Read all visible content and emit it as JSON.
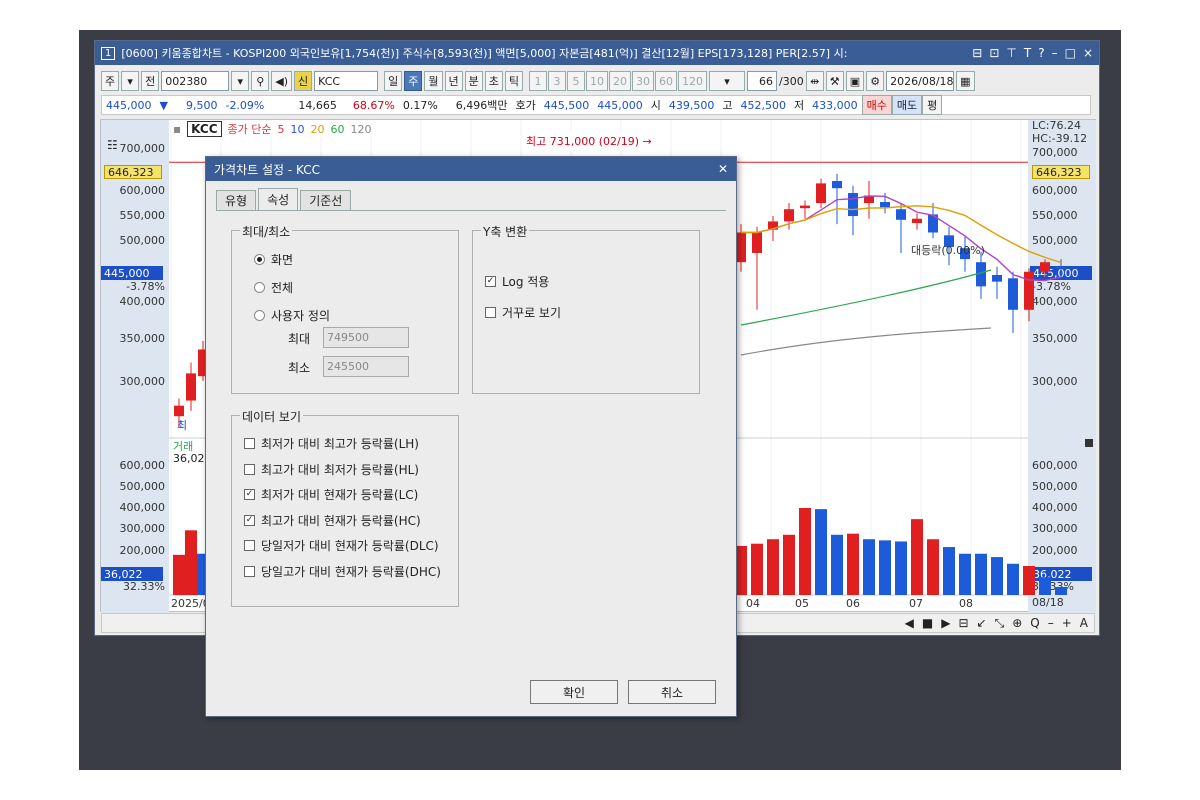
{
  "main_window": {
    "number_badge": "1",
    "title": "[0600] 키움종합차트 - KOSPI200 외국인보유[1,754(천)] 주식수[8,593(천)] 액면[5,000] 자본금[481(억)] 결산[12월] EPS[173,128] PER[2.57] 시:",
    "controls": [
      "⊟",
      "⊡",
      "⊤",
      "T",
      "?",
      "–",
      "□",
      "×"
    ]
  },
  "toolbar": {
    "mode_a": "주",
    "mode_b": "전",
    "code": "002380",
    "badge": "신",
    "stock_name": "KCC",
    "periods": [
      "일",
      "주",
      "월",
      "년",
      "분",
      "초",
      "틱"
    ],
    "active_period": "주",
    "intervals": [
      "1",
      "3",
      "5",
      "10",
      "20",
      "30",
      "60",
      "120"
    ],
    "count": "66",
    "count_total": "/300",
    "date": "2026/08/18"
  },
  "quote": {
    "price": "445,000",
    "arrow": "▼",
    "change": "9,500",
    "change_pct": "-2.09%",
    "volume": "14,665",
    "vol_ratio": "68.67%",
    "turnover": "0.17%",
    "amount": "6,496백만",
    "bid_label": "호가",
    "ask_price": "445,500",
    "bid_price": "445,000",
    "open_label": "시",
    "open": "439,500",
    "high_label": "고",
    "high": "452,500",
    "low_label": "저",
    "low": "433,000",
    "buy": "매수",
    "sell": "매도",
    "eval": "평"
  },
  "chart": {
    "stock_tag": "KCC",
    "ma_label": "종가 단순",
    "ma_periods": [
      "5",
      "10",
      "20",
      "60",
      "120"
    ],
    "ma_colors": [
      "#e8323c",
      "#2a4fd8",
      "#e0a000",
      "#2aa84a",
      "#888888"
    ],
    "high_annot": "최고 731,000 (02/19) →",
    "low_annot_partial": "최",
    "rise_annot": "대등락(0.00%)",
    "lc_label": "LC:76.24",
    "hc_label": "HC:-39.12",
    "price_ticks": [
      "700,000",
      "646,323",
      "600,000",
      "550,000",
      "500,000",
      "445,000",
      "-3.78%",
      "400,000",
      "350,000",
      "300,000"
    ],
    "marker_high": "646,323",
    "marker_cur": "445,000",
    "marker_cur_pct": "-3.78%",
    "volume_label": "거래",
    "volume_value": "36,022",
    "vol_ticks": [
      "600,000",
      "500,000",
      "400,000",
      "300,000",
      "200,000"
    ],
    "vol_marker": "36,022",
    "vol_marker_pct": "32.33%",
    "x_labels": [
      "2025/0",
      "04",
      "05",
      "06",
      "07",
      "08"
    ],
    "x_last": "08/18"
  },
  "chart_data": {
    "type": "candlestick",
    "candles": [
      {
        "o": 265000,
        "h": 282000,
        "l": 255000,
        "c": 275000,
        "up": true
      },
      {
        "o": 280000,
        "h": 320000,
        "l": 270000,
        "c": 308000,
        "up": true
      },
      {
        "o": 305000,
        "h": 345000,
        "l": 300000,
        "c": 335000,
        "up": true
      },
      {
        "o": 455000,
        "h": 520000,
        "l": 440000,
        "c": 505000,
        "up": true
      },
      {
        "o": 470000,
        "h": 515000,
        "l": 385000,
        "c": 505000,
        "up": true
      },
      {
        "o": 510000,
        "h": 535000,
        "l": 490000,
        "c": 525000,
        "up": true
      },
      {
        "o": 525000,
        "h": 560000,
        "l": 510000,
        "c": 548000,
        "up": true
      },
      {
        "o": 550000,
        "h": 565000,
        "l": 530000,
        "c": 555000,
        "up": true
      },
      {
        "o": 560000,
        "h": 610000,
        "l": 550000,
        "c": 600000,
        "up": true
      },
      {
        "o": 590000,
        "h": 620000,
        "l": 520000,
        "c": 605000,
        "up": false
      },
      {
        "o": 580000,
        "h": 595000,
        "l": 500000,
        "c": 535000,
        "up": false
      },
      {
        "o": 560000,
        "h": 605000,
        "l": 530000,
        "c": 575000,
        "up": true
      },
      {
        "o": 562000,
        "h": 580000,
        "l": 540000,
        "c": 552000,
        "up": false
      },
      {
        "o": 548000,
        "h": 560000,
        "l": 470000,
        "c": 528000,
        "up": false
      },
      {
        "o": 530000,
        "h": 540000,
        "l": 510000,
        "c": 522000,
        "up": true
      },
      {
        "o": 538000,
        "h": 560000,
        "l": 495000,
        "c": 505000,
        "up": false
      },
      {
        "o": 500000,
        "h": 515000,
        "l": 450000,
        "c": 480000,
        "up": false
      },
      {
        "o": 478000,
        "h": 498000,
        "l": 440000,
        "c": 460000,
        "up": false
      },
      {
        "o": 455000,
        "h": 472000,
        "l": 400000,
        "c": 418000,
        "up": false
      },
      {
        "o": 425000,
        "h": 448000,
        "l": 400000,
        "c": 435000,
        "up": false
      },
      {
        "o": 430000,
        "h": 440000,
        "l": 355000,
        "c": 385000,
        "up": false
      },
      {
        "o": 385000,
        "h": 445000,
        "l": 370000,
        "c": 440000,
        "up": true
      },
      {
        "o": 440000,
        "h": 460000,
        "l": 430000,
        "c": 455000,
        "up": true
      },
      {
        "o": 448000,
        "h": 460000,
        "l": 430000,
        "c": 445000,
        "up": false
      }
    ],
    "volumes": [
      {
        "v": 180000,
        "up": true
      },
      {
        "v": 290000,
        "up": true
      },
      {
        "v": 185000,
        "up": false
      },
      {
        "v": 220000,
        "up": true
      },
      {
        "v": 230000,
        "up": true
      },
      {
        "v": 250000,
        "up": true
      },
      {
        "v": 270000,
        "up": true
      },
      {
        "v": 390000,
        "up": true
      },
      {
        "v": 385000,
        "up": false
      },
      {
        "v": 270000,
        "up": false
      },
      {
        "v": 275000,
        "up": true
      },
      {
        "v": 250000,
        "up": false
      },
      {
        "v": 245000,
        "up": false
      },
      {
        "v": 240000,
        "up": false
      },
      {
        "v": 340000,
        "up": true
      },
      {
        "v": 250000,
        "up": true
      },
      {
        "v": 215000,
        "up": false
      },
      {
        "v": 185000,
        "up": false
      },
      {
        "v": 185000,
        "up": false
      },
      {
        "v": 170000,
        "up": false
      },
      {
        "v": 140000,
        "up": false
      },
      {
        "v": 130000,
        "up": true
      },
      {
        "v": 80000,
        "up": false
      },
      {
        "v": 36022,
        "up": false
      }
    ],
    "price_levels": {
      "high": 731000,
      "ref": 646323,
      "current": 445000
    },
    "ylim": [
      245500,
      749500
    ],
    "log_scale": true
  },
  "statusbar": {
    "icons": [
      "◀",
      "■",
      "▶",
      "⊟",
      "↙",
      "⤡",
      "⊕",
      "Q",
      "–",
      "+",
      "A"
    ]
  },
  "dialog": {
    "title": "가격차트 설정 - KCC",
    "close": "✕",
    "tabs": [
      "유형",
      "속성",
      "기준선"
    ],
    "active_tab": "속성",
    "group_minmax": {
      "title": "최대/최소",
      "options": [
        {
          "label": "화면",
          "selected": true
        },
        {
          "label": "전체",
          "selected": false
        },
        {
          "label": "사용자 정의",
          "selected": false
        }
      ],
      "max_label": "최대",
      "max_value": "749500",
      "min_label": "최소",
      "min_value": "245500"
    },
    "group_y": {
      "title": "Y축 변환",
      "options": [
        {
          "label": "Log 적용",
          "checked": true
        },
        {
          "label": "거꾸로 보기",
          "checked": false
        }
      ]
    },
    "group_data": {
      "title": "데이터 보기",
      "options": [
        {
          "label": "최저가 대비 최고가 등락률(LH)",
          "checked": false
        },
        {
          "label": "최고가 대비 최저가 등락률(HL)",
          "checked": false
        },
        {
          "label": "최저가 대비 현재가 등락률(LC)",
          "checked": true
        },
        {
          "label": "최고가 대비 현재가 등락률(HC)",
          "checked": true
        },
        {
          "label": "당일저가 대비 현재가 등락률(DLC)",
          "checked": false
        },
        {
          "label": "당일고가 대비 현재가 등락률(DHC)",
          "checked": false
        }
      ]
    },
    "ok": "확인",
    "cancel": "취소"
  }
}
